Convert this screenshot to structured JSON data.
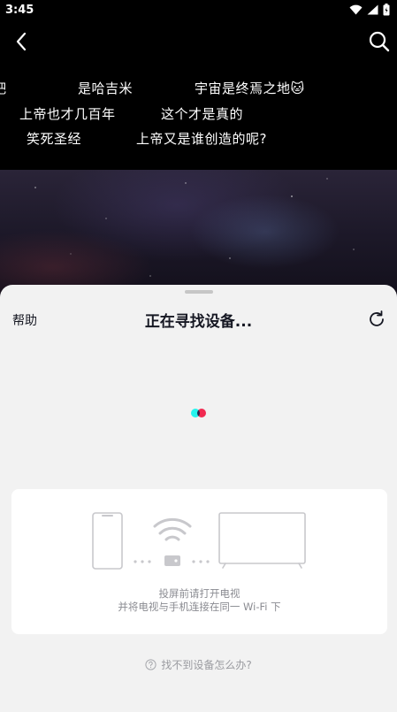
{
  "status_bar": {
    "time": "3:45"
  },
  "danmaku": [
    {
      "text": "吧"
    },
    {
      "text": "是哈吉米"
    },
    {
      "text": "宇宙是终焉之地🐱"
    },
    {
      "text": "上帝也才几百年"
    },
    {
      "text": "这个才是真的"
    },
    {
      "text": "笑死圣经"
    },
    {
      "text": "上帝又是谁创造的呢?"
    }
  ],
  "sheet": {
    "help_label": "帮助",
    "title": "正在寻找设备...",
    "guide_line1": "投屏前请打开电视",
    "guide_line2": "并将电视与手机连接在同一 Wi-Fi 下",
    "faq_label": "找不到设备怎么办?"
  },
  "colors": {
    "brand_cyan": "#25F4EE",
    "brand_red": "#FE2C55",
    "sheet_bg": "#f2f2f2"
  },
  "icons": [
    "back-arrow-icon",
    "search-icon",
    "refresh-icon",
    "help-circle-icon",
    "wifi-icon",
    "phone-icon",
    "tv-icon",
    "router-icon"
  ]
}
